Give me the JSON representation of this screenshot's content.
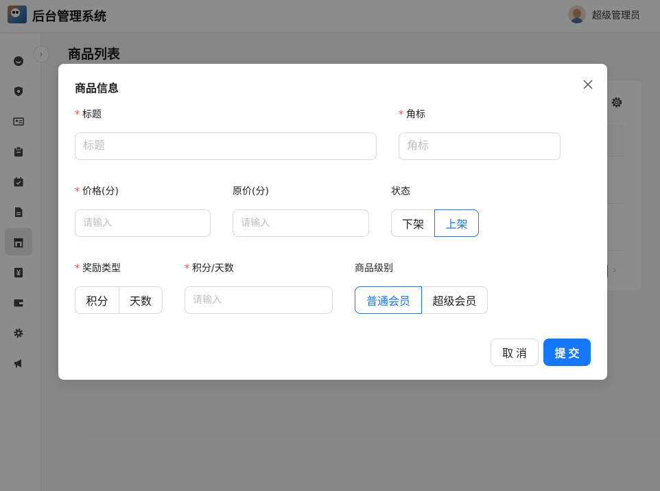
{
  "header": {
    "app_title": "后台管理系统",
    "user_name": "超级管理员"
  },
  "sidebar": {
    "items": [
      {
        "icon": "smile-icon"
      },
      {
        "icon": "shield-icon"
      },
      {
        "icon": "id-card-icon"
      },
      {
        "icon": "clipboard-icon"
      },
      {
        "icon": "calendar-icon"
      },
      {
        "icon": "file-icon"
      },
      {
        "icon": "shop-icon"
      },
      {
        "icon": "money-icon"
      },
      {
        "icon": "wallet-icon"
      },
      {
        "icon": "gear-icon"
      },
      {
        "icon": "notification-icon"
      }
    ],
    "active_item": "shop-icon"
  },
  "page": {
    "title": "商品列表"
  },
  "modal": {
    "title": "商品信息",
    "fields": {
      "title": {
        "label": "标题",
        "required": true,
        "placeholder": "标题",
        "value": ""
      },
      "corner_mark": {
        "label": "角标",
        "required": true,
        "placeholder": "角标",
        "value": ""
      },
      "price": {
        "label": "价格(分)",
        "required": true,
        "placeholder": "请输入",
        "value": ""
      },
      "original_price": {
        "label": "原价(分)",
        "required": false,
        "placeholder": "请输入",
        "value": ""
      },
      "status": {
        "label": "状态",
        "required": false,
        "options": [
          "下架",
          "上架"
        ],
        "selected": "上架"
      },
      "reward_type": {
        "label": "奖励类型",
        "required": true,
        "options": [
          "积分",
          "天数"
        ],
        "selected": ""
      },
      "points_days": {
        "label": "积分/天数",
        "required": true,
        "placeholder": "请输入",
        "value": ""
      },
      "product_level": {
        "label": "商品级别",
        "required": false,
        "options": [
          "普通会员",
          "超级会员"
        ],
        "selected": "普通会员"
      }
    },
    "cancel_label": "取消",
    "submit_label": "提交"
  },
  "colors": {
    "primary": "#1677ff",
    "required_mark": "#ff4d4f",
    "mask": "rgba(0,0,0,0.45)"
  }
}
